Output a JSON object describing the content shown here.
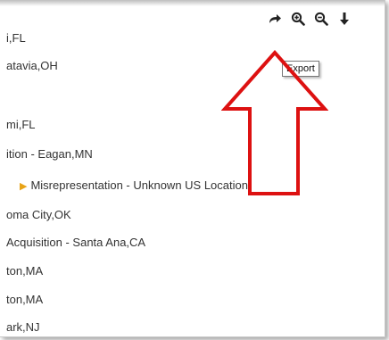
{
  "list": {
    "rows": [
      {
        "text": "i,FL"
      },
      {
        "text": "atavia,OH"
      },
      {
        "text": "mi,FL"
      },
      {
        "text": "ition - Eagan,MN"
      },
      {
        "text": "Misrepresentation - Unknown US Location"
      },
      {
        "text": "oma City,OK"
      },
      {
        "text": "Acquisition - Santa Ana,CA"
      },
      {
        "text": "ton,MA"
      },
      {
        "text": "ton,MA"
      },
      {
        "text": "ark,NJ"
      }
    ]
  },
  "toolbar": {
    "buttons": [
      {
        "icon": "share-arrow-icon"
      },
      {
        "icon": "zoom-in-icon"
      },
      {
        "icon": "zoom-out-icon"
      },
      {
        "icon": "download-icon"
      }
    ]
  },
  "tooltip": {
    "text": "Export"
  },
  "annotation": {
    "color": "#dd1111"
  },
  "colors": {
    "text": "#333333",
    "marker": "#e8a317",
    "icon": "#222222"
  }
}
